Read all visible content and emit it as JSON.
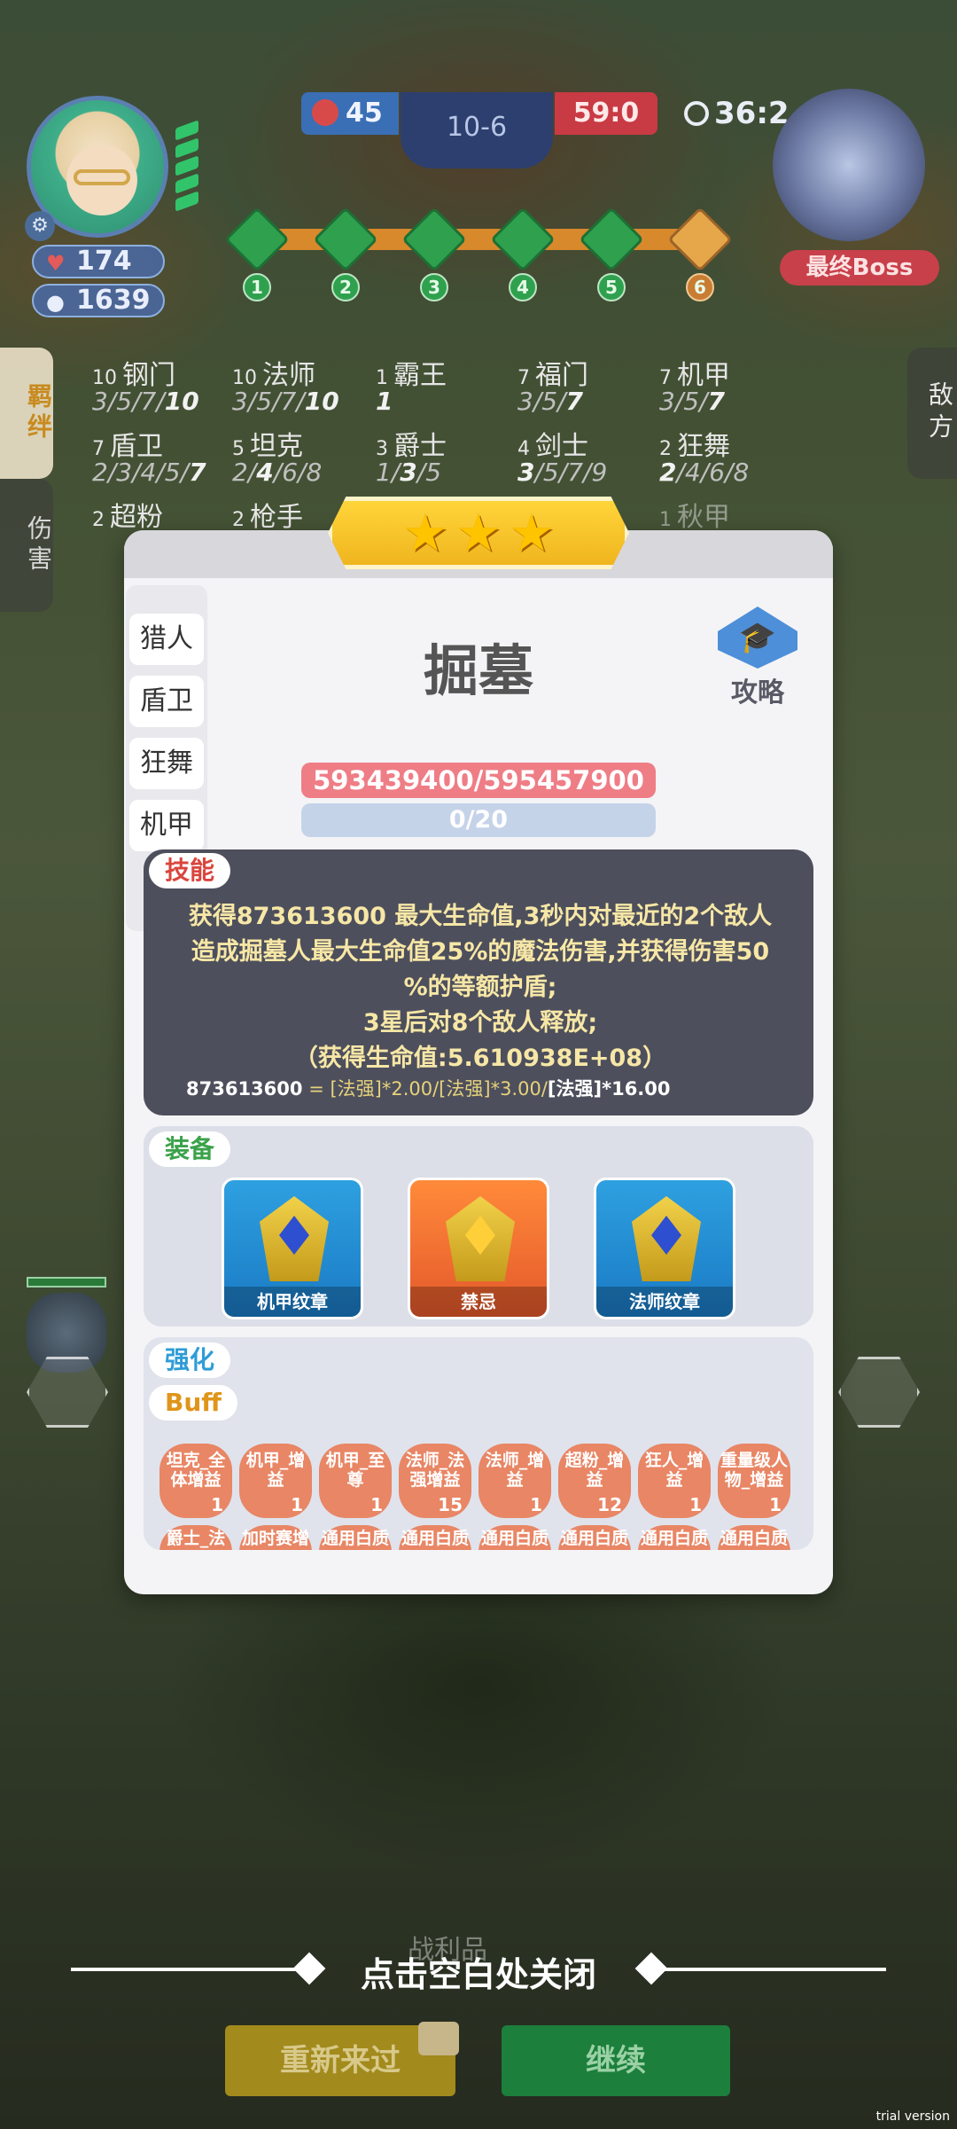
{
  "hud": {
    "left_hp": "174",
    "left_coins": "1639",
    "red_score": "45",
    "round": "10-6",
    "blue_score": "59:0",
    "timer": "36:2",
    "boss_label": "最终Boss",
    "stages": [
      "1",
      "2",
      "3",
      "4",
      "5",
      "6"
    ]
  },
  "side_tabs": {
    "bond": "羁绊",
    "damage": "伤害",
    "enemy": "敌方"
  },
  "synergies": [
    {
      "count": "10",
      "name": "钢门",
      "levels": "3/5/7/10",
      "active": "10"
    },
    {
      "count": "10",
      "name": "法师",
      "levels": "3/5/7/10",
      "active": "10"
    },
    {
      "count": "1",
      "name": "霸王",
      "levels": "1",
      "active": "1"
    },
    {
      "count": "7",
      "name": "福门",
      "levels": "3/5/7",
      "active": "7"
    },
    {
      "count": "7",
      "name": "机甲",
      "levels": "3/5/7",
      "active": "7"
    },
    {
      "count": "7",
      "name": "盾卫",
      "levels": "2/3/4/5/7",
      "active": "7"
    },
    {
      "count": "5",
      "name": "坦克",
      "levels": "2/4/6/8",
      "active": "4"
    },
    {
      "count": "3",
      "name": "爵士",
      "levels": "1/3/5",
      "active": "3"
    },
    {
      "count": "4",
      "name": "剑士",
      "levels": "3/5/7/9",
      "active": "3"
    },
    {
      "count": "2",
      "name": "狂舞",
      "levels": "2/4/6/8",
      "active": "2"
    },
    {
      "count": "2",
      "name": "超粉",
      "levels": "",
      "active": ""
    },
    {
      "count": "2",
      "name": "枪手",
      "levels": "",
      "active": ""
    },
    {
      "count": "1",
      "name": "秋甲",
      "levels": "",
      "active": ""
    }
  ],
  "modal": {
    "stars": 3,
    "class_tabs": [
      "猎人",
      "盾卫",
      "狂舞",
      "机甲"
    ],
    "hero_name": "掘墓",
    "guide_label": "攻略",
    "hp_text": "593439400/595457900",
    "xp_text": "0/20",
    "skill_label": "技能",
    "skill_lines": [
      "获得873613600 最大生命值,3秒内对最近的2个敌人",
      "造成掘墓人最大生命值25%的魔法伤害,并获得伤害50",
      "%的等额护盾;",
      "3星后对8个敌人释放;",
      "（获得生命值:5.610938E+08）"
    ],
    "formula_value": "873613600",
    "formula_expr": " = [法强]*2.00/[法强]*3.00/",
    "formula_tail": "[法强]*16.00",
    "equip_label": "装备",
    "equipment": [
      "机甲纹章",
      "禁忌",
      "法师纹章"
    ],
    "enhance_label": "强化",
    "buff_label": "Buff",
    "buffs": [
      {
        "name": "坦克_全体增益",
        "n": "1"
      },
      {
        "name": "机甲_增益",
        "n": "1"
      },
      {
        "name": "机甲_至尊",
        "n": "1"
      },
      {
        "name": "法师_法强增益",
        "n": "15"
      },
      {
        "name": "法师_增益",
        "n": "1"
      },
      {
        "name": "超粉_增益",
        "n": "12"
      },
      {
        "name": "狂人_增益",
        "n": "1"
      },
      {
        "name": "重量级人物_增益",
        "n": "1"
      }
    ],
    "buffs_row2": [
      "爵士_法",
      "加时赛增",
      "通用白质",
      "通用白质",
      "通用白质",
      "通用白质",
      "通用白质",
      "通用白质"
    ]
  },
  "footer": {
    "loot_title": "战利品",
    "close_hint": "点击空白处关闭",
    "retry": "重新来过",
    "continue": "继续",
    "watermark": "trial version"
  },
  "colors": {
    "accent_gold": "#ffd53a",
    "hp_pink": "#ef7d86",
    "skill_bg": "#4d4f5c",
    "buff_chip": "#e88665",
    "continue_green": "#1c7f3c",
    "retry_yellow": "#a28a1c"
  }
}
